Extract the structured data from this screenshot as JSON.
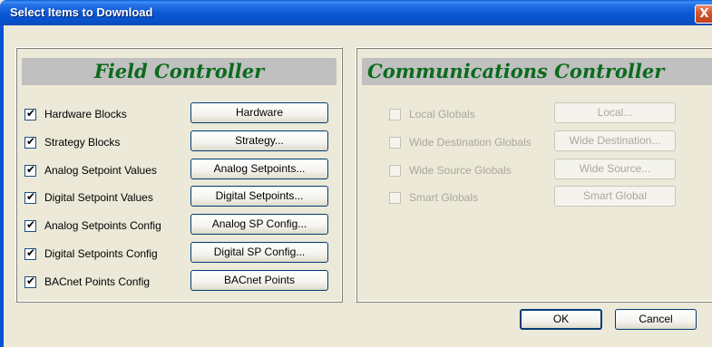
{
  "window": {
    "title": "Select Items to Download",
    "close_glyph": "X"
  },
  "field_controller": {
    "title": "Field Controller",
    "items": [
      {
        "label": "Hardware Blocks",
        "checked": true,
        "button": "Hardware"
      },
      {
        "label": "Strategy Blocks",
        "checked": true,
        "button": "Strategy..."
      },
      {
        "label": "Analog Setpoint Values",
        "checked": true,
        "button": "Analog Setpoints..."
      },
      {
        "label": "Digital Setpoint Values",
        "checked": true,
        "button": "Digital Setpoints..."
      },
      {
        "label": "Analog Setpoints Config",
        "checked": true,
        "button": "Analog SP Config..."
      },
      {
        "label": "Digital Setpoints Config",
        "checked": true,
        "button": "Digital SP Config..."
      },
      {
        "label": "BACnet Points Config",
        "checked": true,
        "button": "BACnet Points"
      }
    ]
  },
  "communications_controller": {
    "title": "Communications Controller",
    "items": [
      {
        "label": "Local Globals",
        "checked": false,
        "enabled": false,
        "button": "Local..."
      },
      {
        "label": "Wide Destination Globals",
        "checked": false,
        "enabled": false,
        "button": "Wide Destination..."
      },
      {
        "label": "Wide Source Globals",
        "checked": false,
        "enabled": false,
        "button": "Wide Source..."
      },
      {
        "label": "Smart Globals",
        "checked": false,
        "enabled": false,
        "button": "Smart Global"
      }
    ]
  },
  "footer": {
    "ok_label": "OK",
    "cancel_label": "Cancel"
  }
}
